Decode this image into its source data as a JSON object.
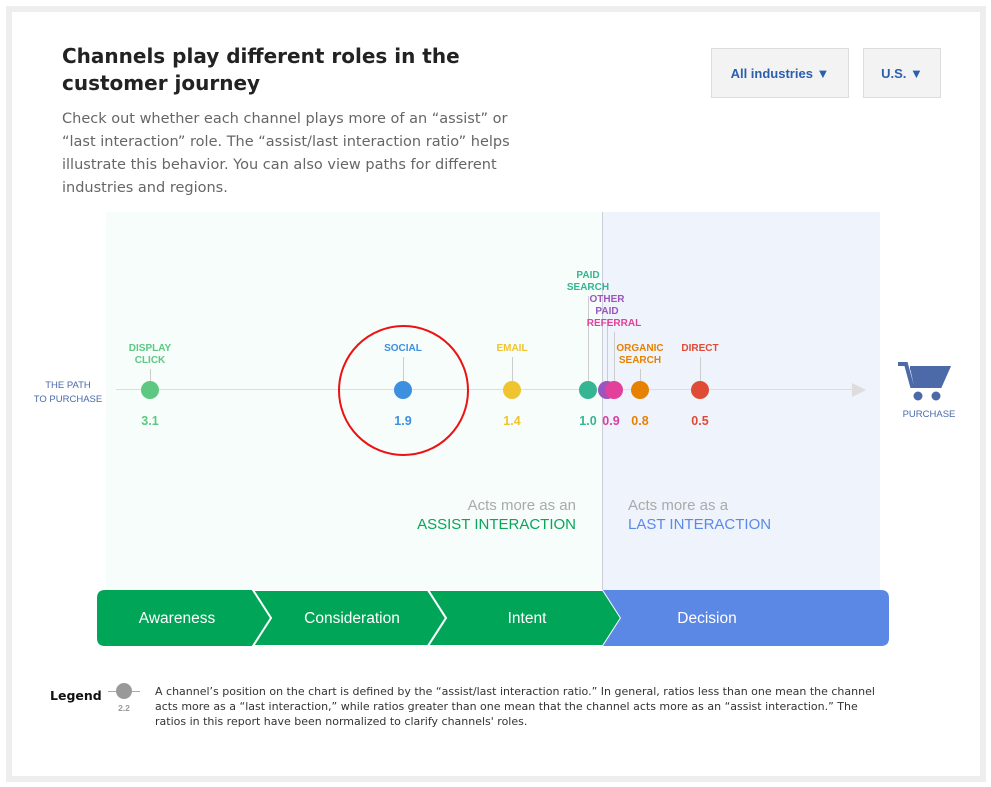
{
  "header": {
    "title": "Channels play different roles in the customer journey",
    "description": "Check out whether each channel plays more of an “assist” or “last interaction” role. The “assist/last interaction ratio” helps illustrate this behavior. You can also view paths for different industries and regions."
  },
  "filters": {
    "industry": "All industries ▼",
    "region": "U.S. ▼"
  },
  "chart": {
    "path_label": [
      "THE PATH",
      "TO PURCHASE"
    ],
    "purchase_label": "PURCHASE",
    "highlighted_channel": "social",
    "channels": [
      {
        "key": "display",
        "label": [
          "DISPLAY",
          "CLICK"
        ],
        "value": "3.1",
        "color": "#5cc882"
      },
      {
        "key": "social",
        "label": [
          "SOCIAL"
        ],
        "value": "1.9",
        "color": "#3d8fe0"
      },
      {
        "key": "email",
        "label": [
          "EMAIL"
        ],
        "value": "1.4",
        "color": "#f0c330"
      },
      {
        "key": "paid",
        "label": [
          "PAID",
          "SEARCH"
        ],
        "value": "1.0",
        "color": "#35b592"
      },
      {
        "key": "other",
        "label": [
          "OTHER",
          "PAID"
        ],
        "value": "0.9",
        "color": "#9b55bd"
      },
      {
        "key": "referral",
        "label": [
          "REFERRAL"
        ],
        "value": "",
        "color": "#e2409a"
      },
      {
        "key": "organic",
        "label": [
          "ORGANIC",
          "SEARCH"
        ],
        "value": "0.8",
        "color": "#e68200"
      },
      {
        "key": "direct",
        "label": [
          "DIRECT"
        ],
        "value": "0.5",
        "color": "#e04b35"
      }
    ],
    "assist": {
      "line1": "Acts more as an",
      "line2": "ASSIST INTERACTION",
      "color": "#0aa45a"
    },
    "last": {
      "line1": "Acts more as a",
      "line2": "LAST INTERACTION",
      "color": "#5a8ae6"
    }
  },
  "stages": [
    {
      "label": "Awareness",
      "color": "#00a558"
    },
    {
      "label": "Consideration",
      "color": "#00a558"
    },
    {
      "label": "Intent",
      "color": "#00a558"
    },
    {
      "label": "Decision",
      "color": "#5b87e5"
    }
  ],
  "legend": {
    "title": "Legend",
    "sample_value": "2.2",
    "text": "A channel’s position on the chart is defined by the “assist/last interaction ratio.” In general, ratios less than one mean the channel acts more as a “last interaction,” while ratios greater than one mean that the channel acts more as an “assist interaction.” The ratios in this report have been normalized to clarify channels' roles."
  }
}
